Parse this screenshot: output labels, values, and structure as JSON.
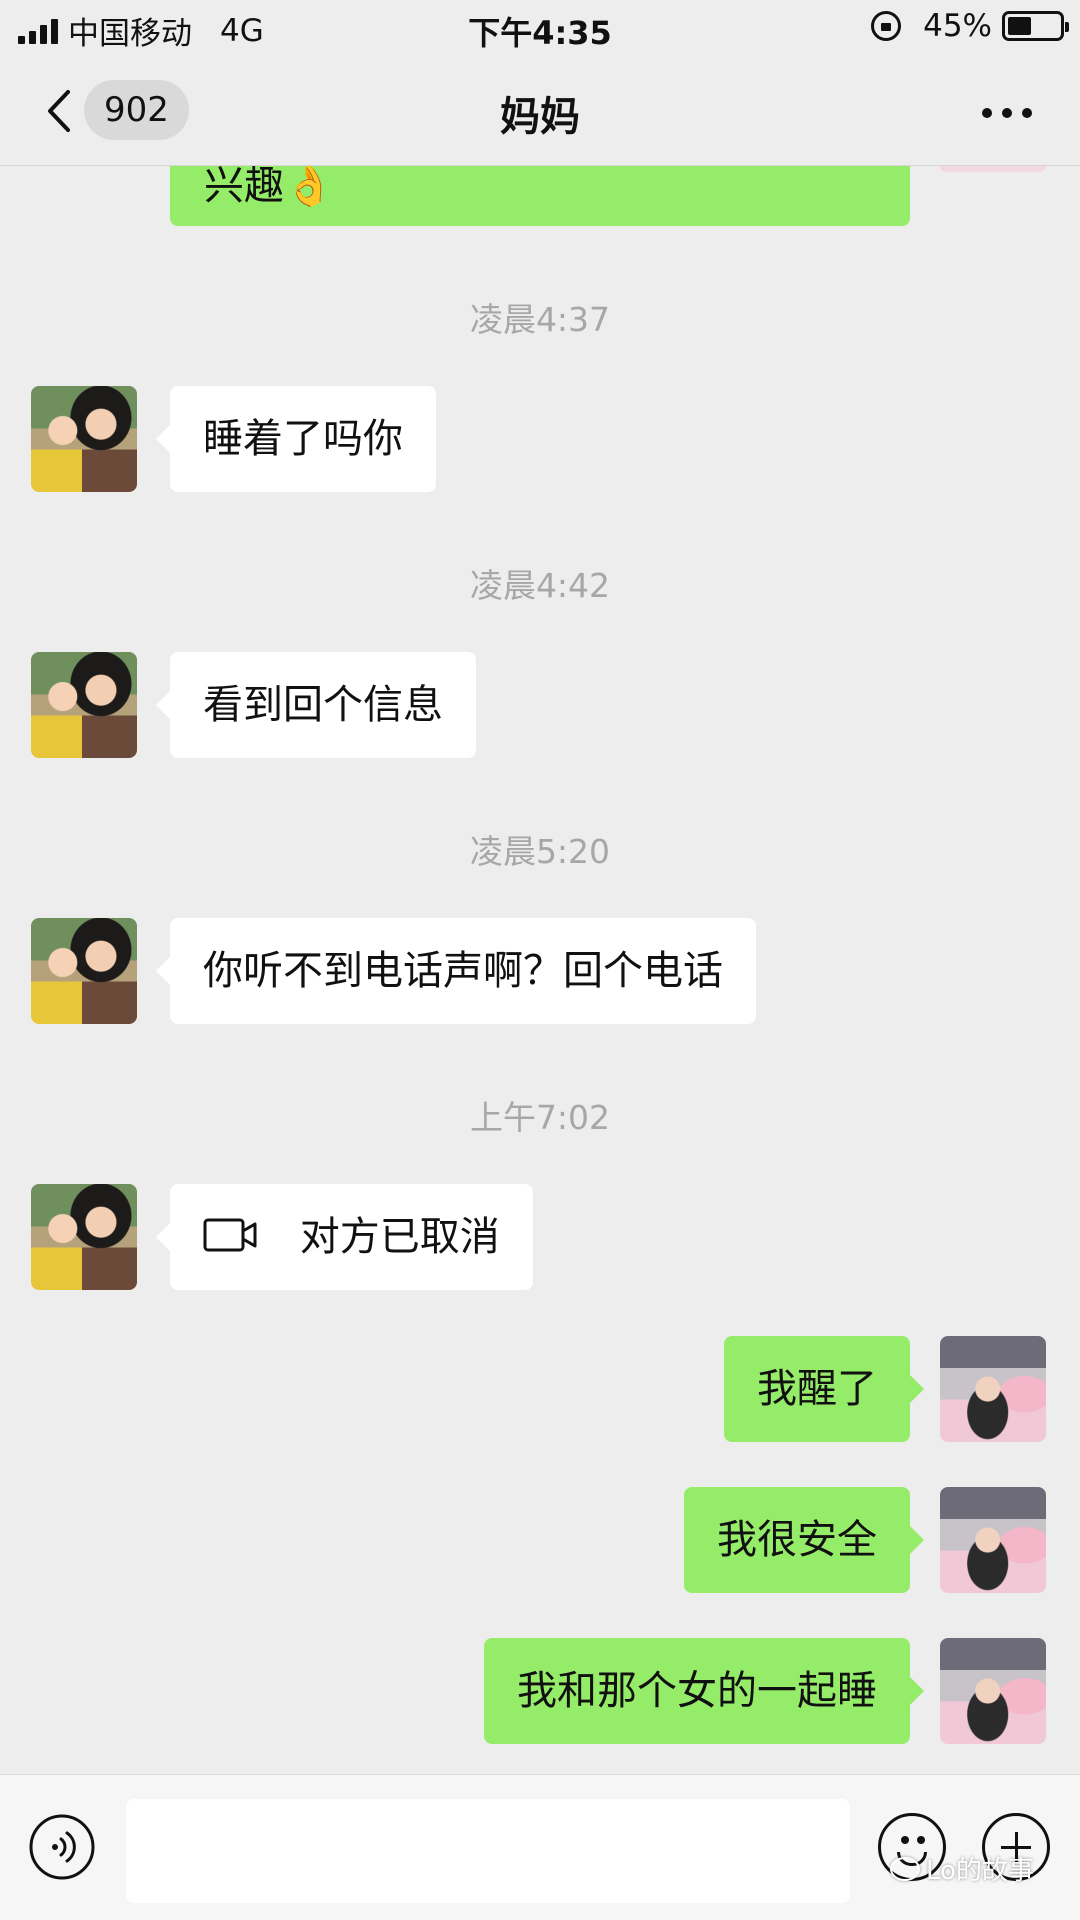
{
  "status_bar": {
    "carrier": "中国移动",
    "network": "4G",
    "time": "下午4:35",
    "battery_percent": "45%",
    "battery_level": 0.45
  },
  "nav": {
    "unread_count": "902",
    "title": "妈妈"
  },
  "messages": {
    "partial_text": "兴趣👌",
    "items": [
      {
        "type": "timestamp",
        "text": "凌晨4:37"
      },
      {
        "type": "in",
        "text": "睡着了吗你"
      },
      {
        "type": "timestamp",
        "text": "凌晨4:42"
      },
      {
        "type": "in",
        "text": "看到回个信息"
      },
      {
        "type": "timestamp",
        "text": "凌晨5:20"
      },
      {
        "type": "in",
        "text": "你听不到电话声啊？回个电话"
      },
      {
        "type": "timestamp",
        "text": "上午7:02"
      },
      {
        "type": "in-call",
        "text": "对方已取消",
        "icon": "video-camera-icon"
      },
      {
        "type": "out",
        "text": "我醒了"
      },
      {
        "type": "out",
        "text": "我很安全"
      },
      {
        "type": "out",
        "text": "我和那个女的一起睡"
      }
    ]
  },
  "input_bar": {
    "voice_icon": "voice-icon",
    "emoji_icon": "emoji-icon",
    "plus_icon": "plus-icon"
  },
  "watermark": {
    "text": "Lo的故事"
  },
  "colors": {
    "background": "#ededed",
    "bubble_out": "#95ec69",
    "bubble_in": "#ffffff",
    "timestamp": "#a7a7a7"
  }
}
